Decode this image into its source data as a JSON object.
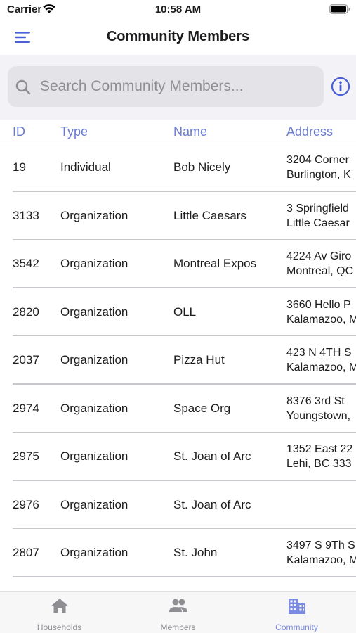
{
  "status": {
    "carrier": "Carrier",
    "time": "10:58 AM"
  },
  "nav": {
    "title": "Community Members"
  },
  "search": {
    "placeholder": "Search Community Members...",
    "value": ""
  },
  "table": {
    "headers": {
      "id": "ID",
      "type": "Type",
      "name": "Name",
      "address": "Address"
    },
    "rows": [
      {
        "id": "19",
        "type": "Individual",
        "name": "Bob Nicely",
        "address1": "3204 Corner",
        "address2": "Burlington, K"
      },
      {
        "id": "3133",
        "type": "Organization",
        "name": "Little Caesars",
        "address1": "3 Springfield",
        "address2": "Little Caesar"
      },
      {
        "id": "3542",
        "type": "Organization",
        "name": "Montreal Expos",
        "address1": "4224 Av Giro",
        "address2": "Montreal, QC"
      },
      {
        "id": "2820",
        "type": "Organization",
        "name": "OLL",
        "address1": "3660 Hello P",
        "address2": "Kalamazoo, M"
      },
      {
        "id": "2037",
        "type": "Organization",
        "name": "Pizza Hut",
        "address1": "423 N 4TH S",
        "address2": "Kalamazoo, M"
      },
      {
        "id": "2974",
        "type": "Organization",
        "name": "Space Org",
        "address1": "8376 3rd St",
        "address2": "Youngstown,"
      },
      {
        "id": "2975",
        "type": "Organization",
        "name": "St. Joan of Arc",
        "address1": "1352 East 22",
        "address2": "Lehi, BC 333"
      },
      {
        "id": "2976",
        "type": "Organization",
        "name": "St. Joan of Arc",
        "address1": "",
        "address2": ""
      },
      {
        "id": "2807",
        "type": "Organization",
        "name": "St. John",
        "address1": "3497 S 9Th S",
        "address2": "Kalamazoo, M"
      }
    ]
  },
  "tabs": [
    {
      "label": "Households",
      "icon": "house-icon",
      "active": false
    },
    {
      "label": "Members",
      "icon": "people-icon",
      "active": false
    },
    {
      "label": "Community",
      "icon": "building-icon",
      "active": true
    }
  ],
  "colors": {
    "accent": "#4a5fd8",
    "header_text": "#6b7bd0",
    "active_tab": "#7b8be0",
    "inactive_tab": "#8e8e93"
  }
}
